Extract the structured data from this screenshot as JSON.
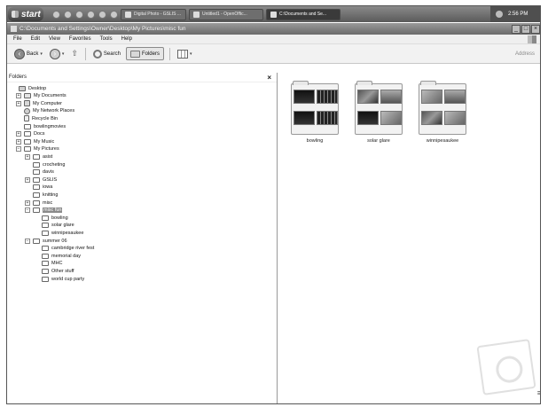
{
  "taskbar": {
    "start_label": "start",
    "tasks": [
      {
        "label": "Digital Photo - GSLIS ...",
        "active": false
      },
      {
        "label": "Untitled1 - OpenOffic...",
        "active": false
      },
      {
        "label": "C:\\Documents and Se...",
        "active": true
      }
    ],
    "clock": "2:56 PM"
  },
  "window": {
    "title": "C:\\Documents and Settings\\Owner\\Desktop\\My Pictures\\misc fun"
  },
  "menu": [
    "File",
    "Edit",
    "View",
    "Favorites",
    "Tools",
    "Help"
  ],
  "toolbar": {
    "back_label": "Back",
    "search_label": "Search",
    "folders_label": "Folders",
    "address_label": "Address"
  },
  "folders_pane": {
    "header": "Folders",
    "close": "×",
    "tree": [
      {
        "label": "Desktop",
        "icon": "desktop-icon",
        "expander": ""
      },
      {
        "label": "My Documents",
        "icon": "documents-icon",
        "expander": "+"
      },
      {
        "label": "My Computer",
        "icon": "computer-icon",
        "expander": "+"
      },
      {
        "label": "My Network Places",
        "icon": "network-icon",
        "expander": ""
      },
      {
        "label": "Recycle Bin",
        "icon": "recycle-bin-icon",
        "expander": ""
      },
      {
        "label": "bowlingmovies",
        "icon": "folder-icon",
        "expander": ""
      },
      {
        "label": "Docs",
        "icon": "folder-icon",
        "expander": "+"
      },
      {
        "label": "My Music",
        "icon": "folder-icon",
        "expander": "+"
      },
      {
        "label": "My Pictures",
        "icon": "folder-icon",
        "expander": "−"
      },
      {
        "label": "asist",
        "icon": "folder-icon",
        "expander": "+"
      },
      {
        "label": "crocheting",
        "icon": "folder-icon",
        "expander": ""
      },
      {
        "label": "davis",
        "icon": "folder-icon",
        "expander": ""
      },
      {
        "label": "GSLIS",
        "icon": "folder-icon",
        "expander": "+"
      },
      {
        "label": "iowa",
        "icon": "folder-icon",
        "expander": ""
      },
      {
        "label": "knitting",
        "icon": "folder-icon",
        "expander": ""
      },
      {
        "label": "misc",
        "icon": "folder-icon",
        "expander": "+"
      },
      {
        "label": "misc fun",
        "icon": "folder-icon",
        "expander": "−",
        "selected": true
      },
      {
        "label": "bowling",
        "icon": "folder-icon",
        "expander": ""
      },
      {
        "label": "solar glare",
        "icon": "folder-icon",
        "expander": ""
      },
      {
        "label": "winnipesaukee",
        "icon": "folder-icon",
        "expander": ""
      },
      {
        "label": "summer 06",
        "icon": "folder-icon",
        "expander": "−"
      },
      {
        "label": "cambridge river fest",
        "icon": "folder-icon",
        "expander": ""
      },
      {
        "label": "memorial day",
        "icon": "folder-icon",
        "expander": ""
      },
      {
        "label": "MHC",
        "icon": "folder-icon",
        "expander": ""
      },
      {
        "label": "Other stuff",
        "icon": "folder-icon",
        "expander": ""
      },
      {
        "label": "world cup party",
        "icon": "folder-icon",
        "expander": ""
      }
    ]
  },
  "content": {
    "items": [
      {
        "label": "bowling"
      },
      {
        "label": "solar glare"
      },
      {
        "label": "winnipesaukee"
      }
    ]
  }
}
